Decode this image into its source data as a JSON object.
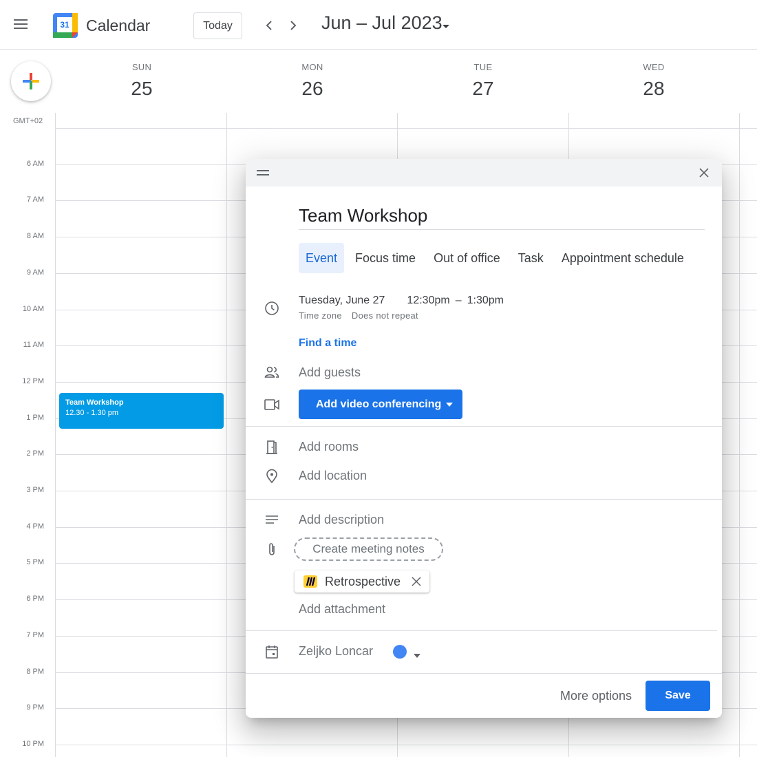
{
  "header": {
    "app_title": "Calendar",
    "logo_number": "31",
    "today_label": "Today",
    "date_range": "Jun – Jul 2023"
  },
  "days": [
    {
      "name": "SUN",
      "num": "25"
    },
    {
      "name": "MON",
      "num": "26"
    },
    {
      "name": "TUE",
      "num": "27"
    },
    {
      "name": "WED",
      "num": "28"
    }
  ],
  "timezone_label": "GMT+02",
  "hours": [
    "6 AM",
    "7 AM",
    "8 AM",
    "9 AM",
    "10 AM",
    "11 AM",
    "12 PM",
    "1 PM",
    "2 PM",
    "3 PM",
    "4 PM",
    "5 PM",
    "6 PM",
    "7 PM",
    "8 PM",
    "9 PM",
    "10 PM"
  ],
  "event_block": {
    "title": "Team Workshop",
    "time": "12.30 - 1.30 pm",
    "color": "#039be5"
  },
  "dialog": {
    "title_value": "Team Workshop",
    "tabs": [
      "Event",
      "Focus time",
      "Out of office",
      "Task",
      "Appointment schedule"
    ],
    "active_tab": "Event",
    "date": "Tuesday, June 27",
    "start_time": "12:30pm",
    "time_separator": "–",
    "end_time": "1:30pm",
    "time_zone": "Time zone",
    "repeat": "Does not repeat",
    "find_time": "Find a time",
    "add_guests": "Add guests",
    "video_conferencing": "Add video conferencing",
    "add_rooms": "Add rooms",
    "add_location": "Add location",
    "add_description": "Add description",
    "meeting_notes": "Create meeting notes",
    "attachment_chip": "Retrospective",
    "add_attachment": "Add attachment",
    "owner": "Zeljko Loncar",
    "owner_color": "#4285f4",
    "more_options": "More options",
    "save": "Save"
  }
}
